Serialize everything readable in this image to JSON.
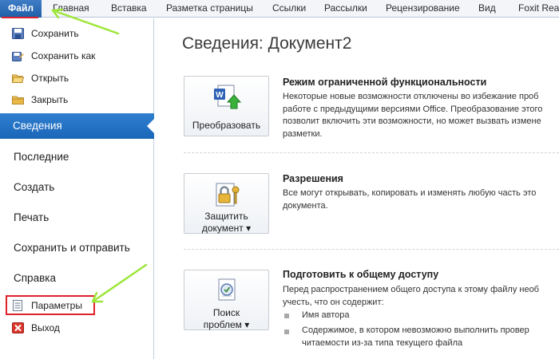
{
  "tabs": [
    {
      "label": "Файл"
    },
    {
      "label": "Главная"
    },
    {
      "label": "Вставка"
    },
    {
      "label": "Разметка страницы"
    },
    {
      "label": "Ссылки"
    },
    {
      "label": "Рассылки"
    },
    {
      "label": "Рецензирование"
    },
    {
      "label": "Вид"
    },
    {
      "label": "Foxit Reader"
    }
  ],
  "left_commands": [
    {
      "label": "Сохранить",
      "icon": "save-icon"
    },
    {
      "label": "Сохранить как",
      "icon": "save-as-icon"
    },
    {
      "label": "Открыть",
      "icon": "open-folder-icon"
    },
    {
      "label": "Закрыть",
      "icon": "close-folder-icon"
    }
  ],
  "nav": {
    "info": "Сведения",
    "recent": "Последние",
    "create": "Создать",
    "print": "Печать",
    "send": "Сохранить и отправить",
    "help": "Справка",
    "options": "Параметры",
    "exit": "Выход"
  },
  "main": {
    "title": "Сведения: Документ2",
    "sections": [
      {
        "button": [
          "Преобразовать"
        ],
        "icon": "convert-document-icon",
        "title": "Режим ограниченной функциональности",
        "body": [
          "Некоторые новые возможности отключены во избежание проб",
          "работе с предыдущими версиями Office. Преобразование этого",
          "позволит включить эти возможности, но может вызвать измене",
          "разметки."
        ]
      },
      {
        "button": [
          "Защитить",
          "документ ▾"
        ],
        "icon": "protect-document-icon",
        "title": "Разрешения",
        "body": [
          "Все могут открывать, копировать и изменять любую часть это",
          "документа."
        ]
      },
      {
        "button": [
          "Поиск",
          "проблем ▾"
        ],
        "icon": "check-issues-icon",
        "title": "Подготовить к общему доступу",
        "body": [
          "Перед распространением общего доступа к этому файлу необ",
          "учесть, что он содержит:"
        ],
        "bullets": [
          [
            "Имя автора"
          ],
          [
            "Содержимое, в котором невозможно выполнить провер",
            "читаемости из-за типа текущего файла"
          ]
        ]
      }
    ]
  },
  "colors": {
    "file_tab": "#1f5ea8",
    "selected_nav": "#1a66b9",
    "annotation_red": "#e0212b",
    "annotation_green": "#9ee63a"
  }
}
